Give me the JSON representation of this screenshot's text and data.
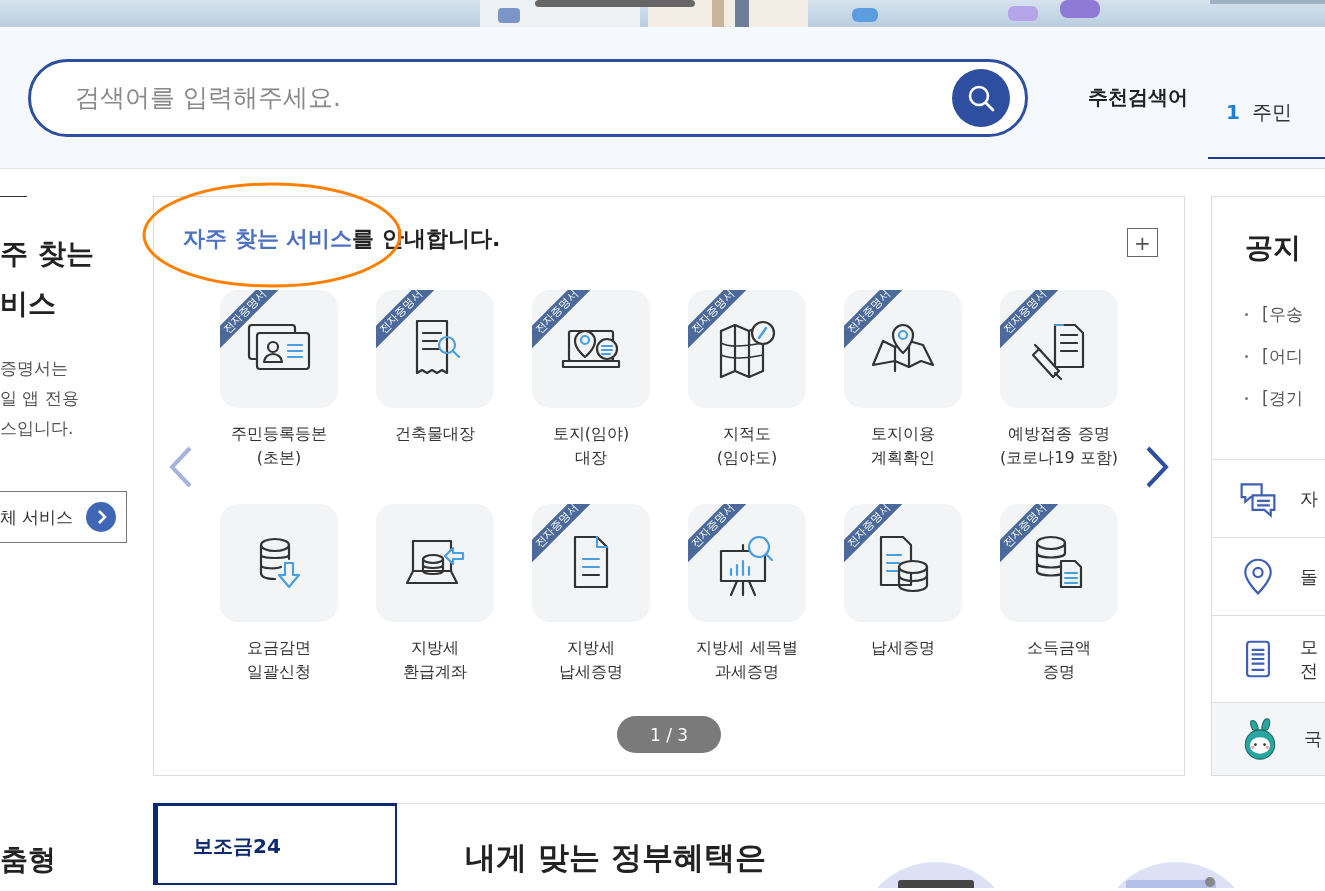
{
  "search": {
    "placeholder": "검색어를 입력해주세요."
  },
  "recommended": {
    "label": "추천검색어",
    "items": [
      {
        "rank": "1",
        "text": "주민"
      }
    ]
  },
  "left_intro": {
    "heading": [
      "주 찾는",
      "비스"
    ],
    "lines": [
      "증명서는",
      "일 앱 전용",
      "스입니다."
    ],
    "button": "체 서비스"
  },
  "services": {
    "title_highlight": "자주 찾는 서비스",
    "title_rest": "를 안내합니다.",
    "more": "+",
    "prev": {
      "disabled": true
    },
    "next": {
      "disabled": false
    },
    "pager": "1 / 3",
    "items": [
      {
        "label": [
          "주민등록등본",
          "(초본)"
        ],
        "badge": "전자증명서"
      },
      {
        "label": [
          "건축물대장"
        ],
        "badge": "전자증명서"
      },
      {
        "label": [
          "토지(임야)",
          "대장"
        ],
        "badge": "전자증명서"
      },
      {
        "label": [
          "지적도",
          "(임야도)"
        ],
        "badge": "전자증명서"
      },
      {
        "label": [
          "토지이용",
          "계획확인"
        ],
        "badge": "전자증명서"
      },
      {
        "label": [
          "예방접종 증명",
          "(코로나19 포함)"
        ],
        "badge": "전자증명서"
      },
      {
        "label": [
          "요금감면",
          "일괄신청"
        ]
      },
      {
        "label": [
          "지방세",
          "환급계좌"
        ]
      },
      {
        "label": [
          "지방세",
          "납세증명"
        ],
        "badge": "전자증명서"
      },
      {
        "label": [
          "지방세 세목별",
          "과세증명"
        ],
        "badge": "전자증명서"
      },
      {
        "label": [
          "납세증명"
        ],
        "badge": "전자증명서"
      },
      {
        "label": [
          "소득금액",
          "증명"
        ],
        "badge": "전자증명서"
      }
    ]
  },
  "notice": {
    "heading": "공지",
    "items": [
      "[우송",
      "[어디",
      "[경기"
    ]
  },
  "quick_menu": [
    {
      "kind": "chat",
      "lines": [
        "자"
      ]
    },
    {
      "kind": "pin",
      "lines": [
        "돌"
      ]
    },
    {
      "kind": "mobile",
      "lines": [
        "모",
        "전"
      ]
    },
    {
      "kind": "mascot",
      "lines": [
        "국"
      ]
    }
  ],
  "lower": {
    "left_heading": "춤형",
    "tab": {
      "label": "보조금24",
      "selected": true
    },
    "heading": "내게 맞는 정부혜택은"
  }
}
